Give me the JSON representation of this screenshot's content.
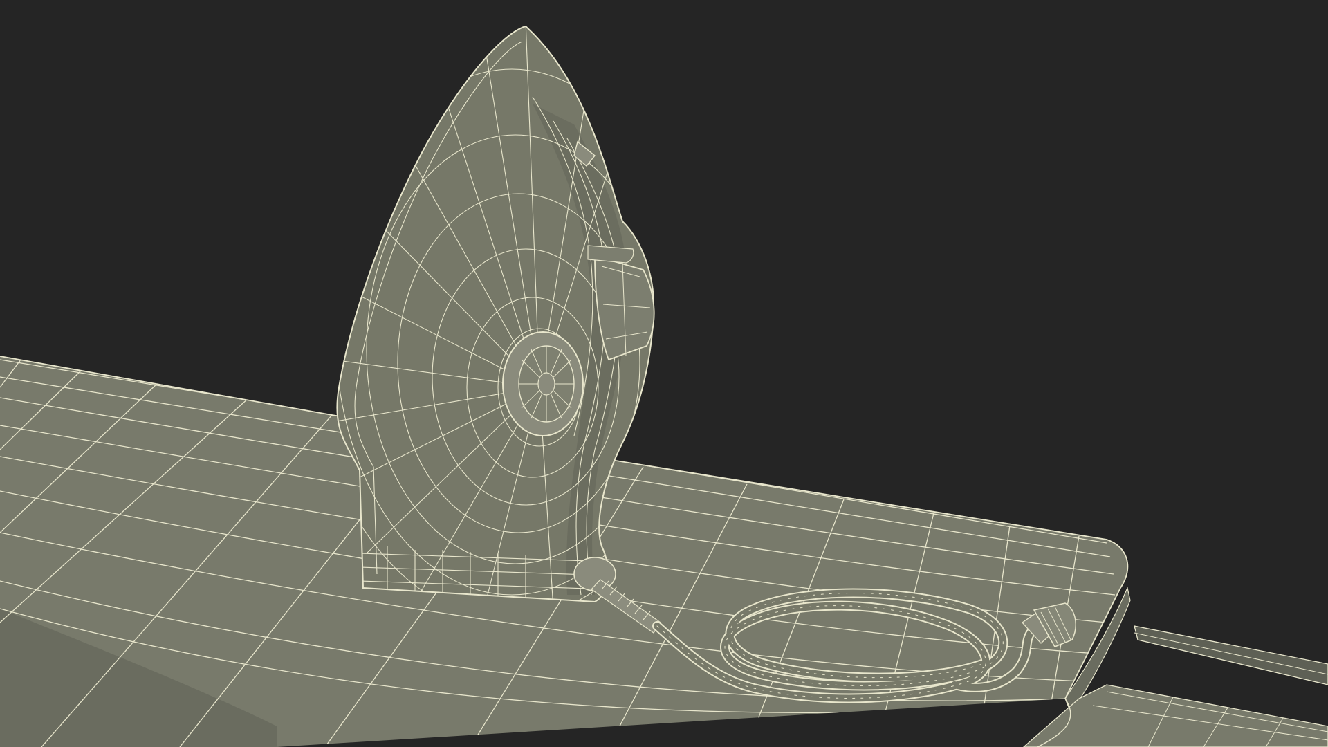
{
  "scene": {
    "background_color": "#252525",
    "surface_color": "#787a6b",
    "surface_shade_color": "#676a5c",
    "wire_color": "#e8e6cc",
    "render_style": "wireframe-over-shaded",
    "objects": [
      "ironing-board",
      "clothes-iron",
      "power-cord",
      "plug"
    ]
  }
}
